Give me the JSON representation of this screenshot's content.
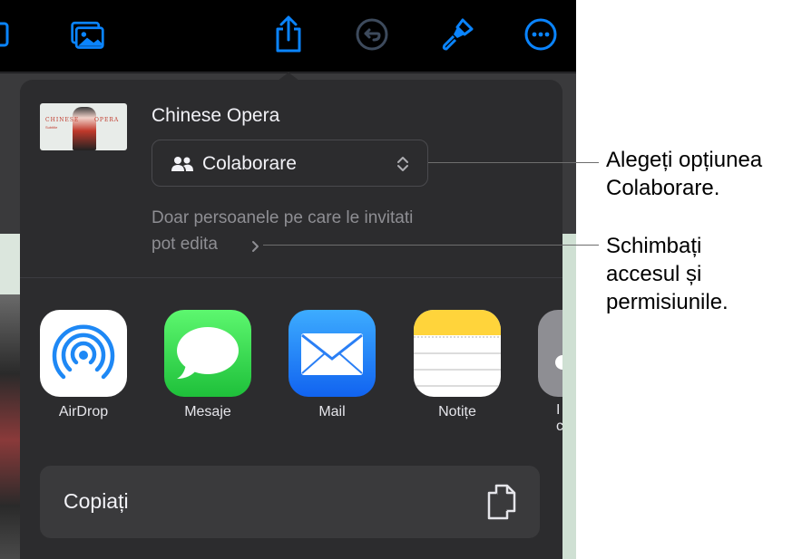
{
  "toolbar": {
    "icons": [
      "new-slide-icon",
      "media-icon",
      "share-icon",
      "undo-icon",
      "format-brush-icon",
      "more-icon"
    ],
    "accent_color": "#0a84ff"
  },
  "share_sheet": {
    "doc_title": "Chinese Opera",
    "thumbnail": {
      "title_left": "CHINESE",
      "title_right": "OPERA",
      "subtitle": "Subtitle"
    },
    "collaboration": {
      "selected": "Colaborare",
      "icon": "people-icon"
    },
    "access": {
      "line1": "Doar persoanele pe care le invitati",
      "line2": "pot edita"
    },
    "apps": [
      {
        "label": "AirDrop",
        "icon": "airdrop-icon"
      },
      {
        "label": "Mesaje",
        "icon": "messages-icon"
      },
      {
        "label": "Mail",
        "icon": "mail-icon"
      },
      {
        "label": "Notițe",
        "icon": "notes-icon"
      },
      {
        "label": "I",
        "label_line2": "c",
        "icon": "partial-app-icon"
      }
    ],
    "copy_action": {
      "label": "Copiați",
      "icon": "copy-icon"
    }
  },
  "callouts": [
    {
      "lines": [
        "Alegeți opțiunea",
        "Colaborare."
      ]
    },
    {
      "lines": [
        "Schimbați",
        "accesul și",
        "permisiunile."
      ]
    }
  ]
}
